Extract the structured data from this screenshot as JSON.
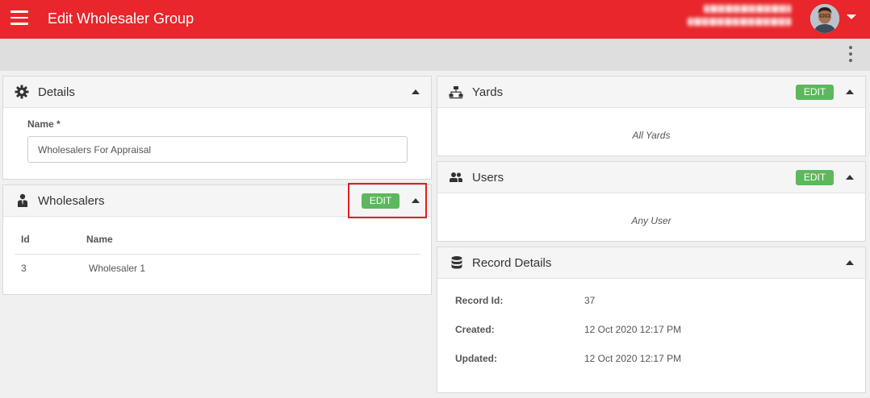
{
  "app_bar": {
    "title": "Edit Wholesaler Group",
    "menu_icon": "hamburger-menu-icon",
    "user_menu_icon": "caret-down-icon",
    "accent_color": "#e8262b"
  },
  "toolbar": {
    "more_icon": "more-vertical-icon"
  },
  "details": {
    "title": "Details",
    "icon": "gear-icon",
    "name_label": "Name *",
    "name_value": "Wholesalers For Appraisal"
  },
  "wholesalers": {
    "title": "Wholesalers",
    "icon": "person-icon",
    "edit_label": "EDIT",
    "columns": [
      "Id",
      "Name"
    ],
    "rows": [
      {
        "id": "3",
        "name": "Wholesaler 1"
      }
    ]
  },
  "yards": {
    "title": "Yards",
    "icon": "network-icon",
    "edit_label": "EDIT",
    "empty_text": "All Yards"
  },
  "users": {
    "title": "Users",
    "icon": "users-icon",
    "edit_label": "EDIT",
    "empty_text": "Any User"
  },
  "record_details": {
    "title": "Record Details",
    "icon": "database-icon",
    "record_id_label": "Record Id:",
    "record_id_value": "37",
    "created_label": "Created:",
    "created_value": "12 Oct 2020 12:17 PM",
    "updated_label": "Updated:",
    "updated_value": "12 Oct 2020 12:17 PM"
  },
  "colors": {
    "edit_button": "#5cb85c",
    "highlight": "#e02020"
  }
}
